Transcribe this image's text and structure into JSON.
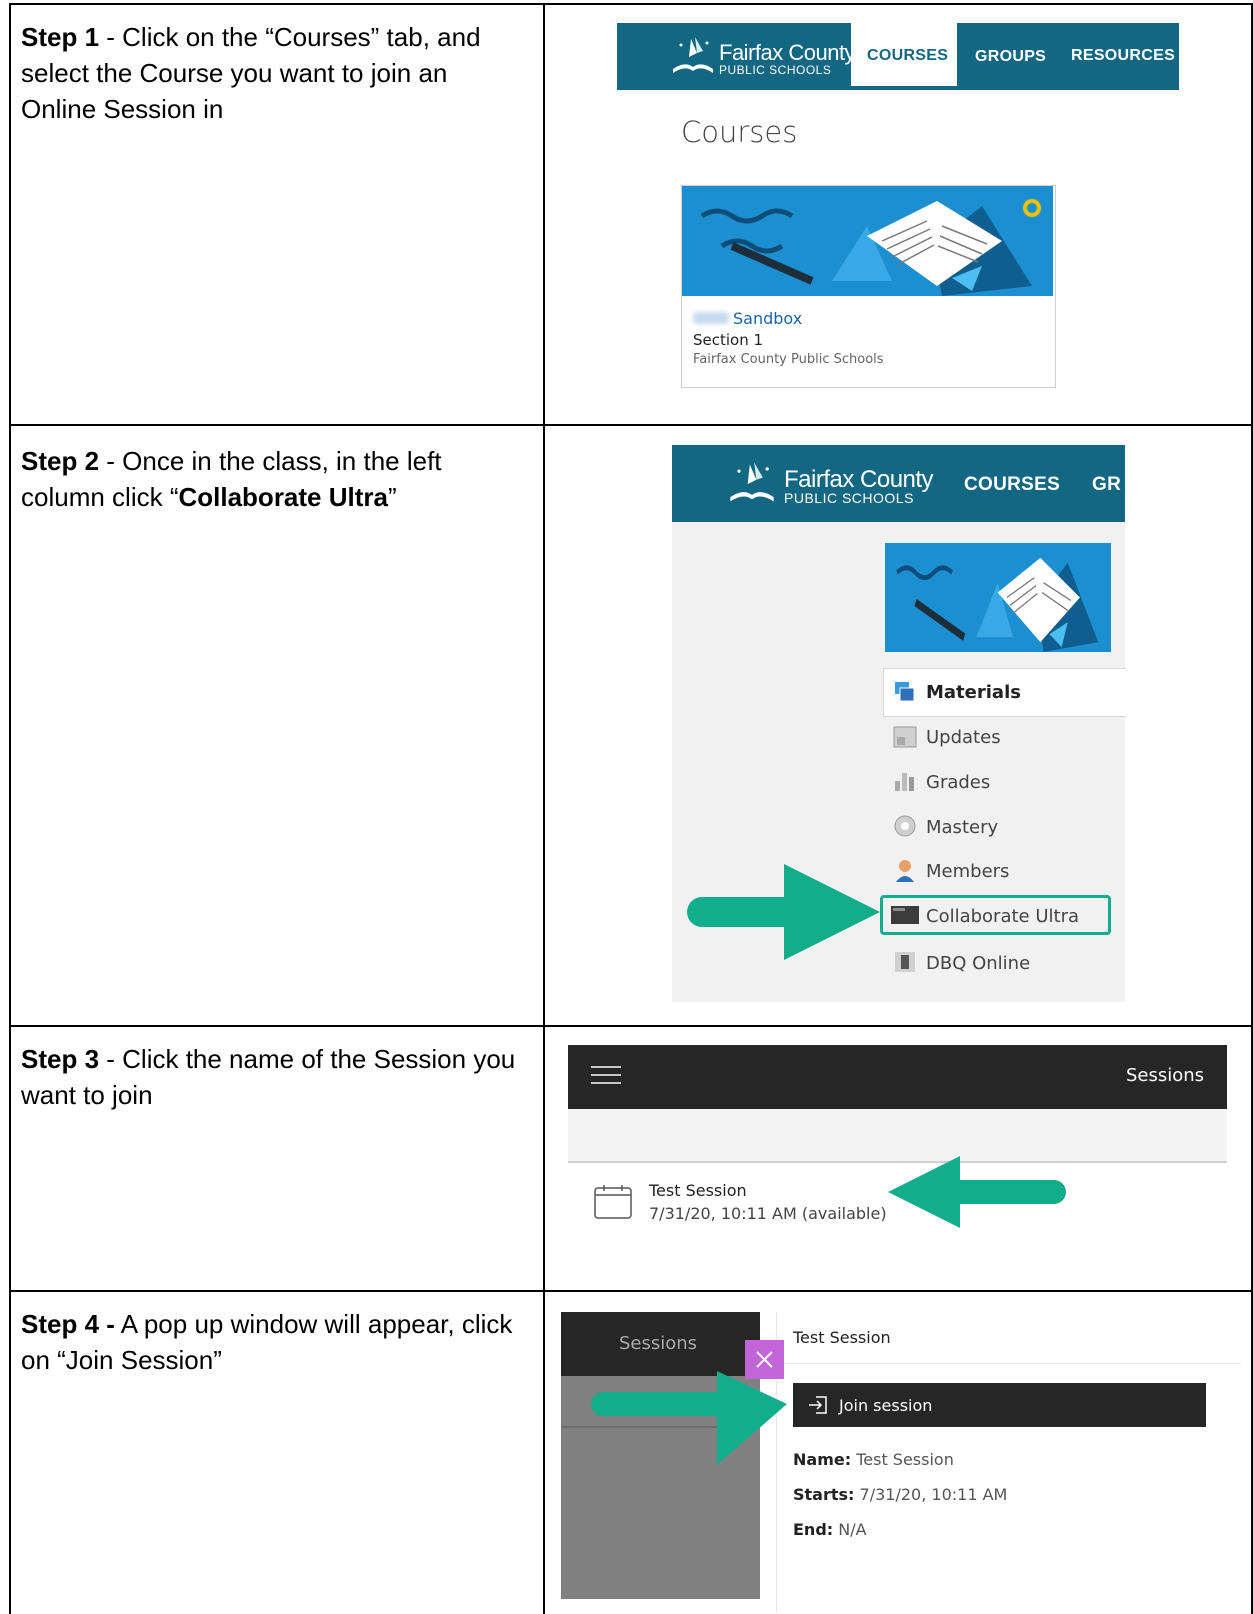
{
  "steps": [
    {
      "label": "Step 1",
      "separator": " - ",
      "text": "Click on the “Courses” tab, and select the Course you want to join an Online Session in"
    },
    {
      "label": "Step 2",
      "separator": " - ",
      "text_before": "Once in the class, in the left column click “",
      "bold_text": "Collaborate Ultra",
      "text_after": "”"
    },
    {
      "label": "Step 3",
      "separator": " - ",
      "text": "Click the name of the Session you want to join"
    },
    {
      "label": "Step 4 -",
      "separator": " ",
      "text": "A pop up window will appear, click on “Join Session”"
    }
  ],
  "logo": {
    "name": "Fairfax County",
    "subtitle": "PUBLIC SCHOOLS"
  },
  "screenshot1": {
    "tabs": [
      "COURSES",
      "GROUPS",
      "RESOURCES"
    ],
    "page_title": "Courses",
    "course_card": {
      "name": "Sandbox",
      "section": "Section 1",
      "org": "Fairfax County Public Schools"
    }
  },
  "screenshot2": {
    "tabs": [
      "COURSES",
      "GR"
    ],
    "menu": [
      "Materials",
      "Updates",
      "Grades",
      "Mastery",
      "Members",
      "Collaborate Ultra",
      "DBQ Online"
    ]
  },
  "screenshot3": {
    "title": "Sessions",
    "session_name": "Test Session",
    "session_time": "7/31/20, 10:11 AM (available)"
  },
  "screenshot4": {
    "sidebar_title": "Sessions",
    "popup_title": "Test Session",
    "join_label": "Join session",
    "details": [
      {
        "label": "Name:",
        "value": "Test Session"
      },
      {
        "label": "Starts:",
        "value": "7/31/20, 10:11 AM"
      },
      {
        "label": "End:",
        "value": "N/A"
      }
    ]
  },
  "colors": {
    "brand_teal": "#146783",
    "arrow_green": "#12ae8c",
    "close_purple": "#c265d8",
    "dark_bar": "#262626"
  }
}
